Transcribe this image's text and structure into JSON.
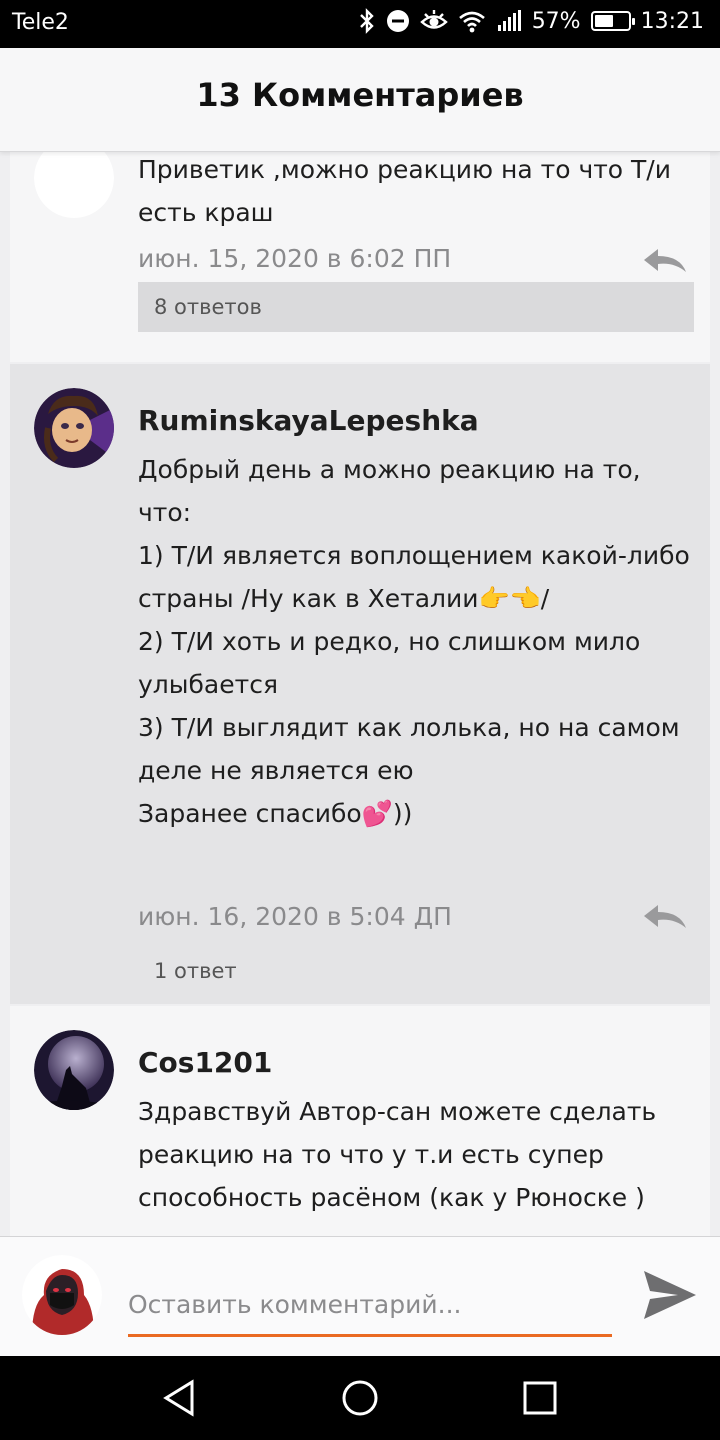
{
  "status": {
    "carrier": "Tele2",
    "battery": "57%",
    "battery_level": 0.57,
    "time": "13:21",
    "icons": [
      "bluetooth-icon",
      "do-not-disturb-icon",
      "eye-comfort-icon",
      "wifi-icon",
      "signal-icon",
      "battery-icon"
    ]
  },
  "header": {
    "title": "13 Комментариев"
  },
  "comments": [
    {
      "author": "",
      "text": "Приветик ,можно реакцию на то что Т/и есть краш",
      "date": "июн. 15, 2020 в 6:02 ПП",
      "replies": "8 ответов"
    },
    {
      "author": "RuminskayaLepeshka",
      "text": "Добрый день а можно реакцию на то, что:\n1) Т/И является воплощением какой-либо страны /Ну как в Хеталии👉👈/\n2) Т/И хоть и редко, но слишком мило улыбается\n3) Т/И выглядит как лолька, но на самом деле не является ею\nЗаранее спасибо💕))",
      "date": "июн. 16, 2020 в 5:04 ДП",
      "replies": "1 ответ"
    },
    {
      "author": "Cos1201",
      "text": "Здравствуй Автор-сан можете сделать реакцию на то что у т.и есть супер способность расёном (как у Рюноске )",
      "date": "",
      "replies": ""
    }
  ],
  "composer": {
    "placeholder": "Оставить комментарий..."
  },
  "colors": {
    "accent": "#ea6a22",
    "header_bg": "#f7f7f8",
    "highlight_bg": "#e4e4e6"
  },
  "navbar": {
    "icons": [
      "back-icon",
      "home-icon",
      "recents-icon"
    ]
  }
}
